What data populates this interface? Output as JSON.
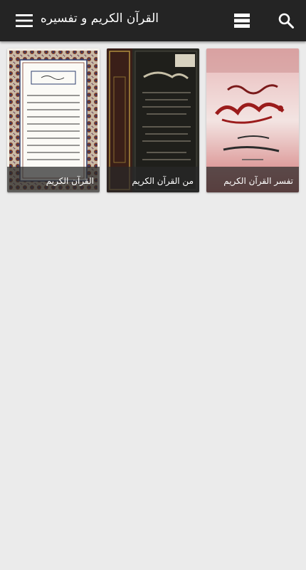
{
  "header": {
    "title": "القرآن الكريم و تفسيره",
    "icons": {
      "search": "search-icon",
      "list": "list-icon",
      "menu": "menu-icon"
    }
  },
  "colors": {
    "appbar": "#242424",
    "background": "#ebebeb",
    "caption_overlay": "rgba(40,40,40,0.72)"
  },
  "books": [
    {
      "caption": "تفسر القرآن الكريم",
      "cover": "red-calligraphy-cover"
    },
    {
      "caption": "من القرآن الكريم",
      "cover": "dark-ornate-cover"
    },
    {
      "caption": "القرآن الكريم",
      "cover": "patterned-mushaf-page"
    }
  ]
}
